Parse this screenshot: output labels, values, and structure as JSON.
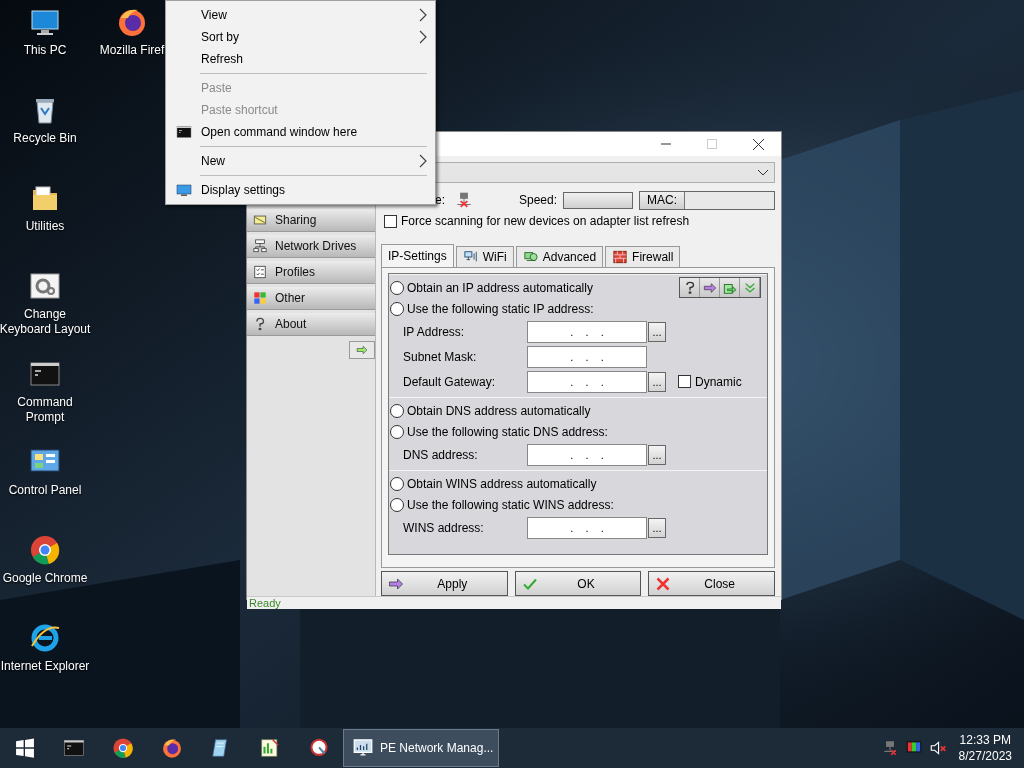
{
  "desktop": {
    "columns": [
      [
        {
          "label": "This PC",
          "kind": "pc"
        },
        {
          "label": "Recycle Bin",
          "kind": "recycle"
        },
        {
          "label": "Utilities",
          "kind": "folder"
        },
        {
          "label": "Change Keyboard Layout",
          "kind": "gear"
        },
        {
          "label": "Command Prompt",
          "kind": "cmd"
        },
        {
          "label": "Control Panel",
          "kind": "control"
        },
        {
          "label": "Google Chrome",
          "kind": "chrome"
        },
        {
          "label": "Internet Explorer",
          "kind": "ie"
        }
      ],
      [
        {
          "label": "Mozilla Firef",
          "kind": "firefox"
        }
      ]
    ]
  },
  "context_menu": {
    "items": [
      {
        "kind": "item",
        "label": "View",
        "disabled": false,
        "submenu": true
      },
      {
        "kind": "item",
        "label": "Sort by",
        "disabled": false,
        "submenu": true
      },
      {
        "kind": "item",
        "label": "Refresh",
        "disabled": false,
        "submenu": false
      },
      {
        "kind": "separator"
      },
      {
        "kind": "item",
        "label": "Paste",
        "disabled": true,
        "submenu": false
      },
      {
        "kind": "item",
        "label": "Paste shortcut",
        "disabled": true,
        "submenu": false
      },
      {
        "kind": "command",
        "label": "Open command window here",
        "disabled": false,
        "submenu": false
      },
      {
        "kind": "separator"
      },
      {
        "kind": "item",
        "label": "New",
        "disabled": false,
        "submenu": true
      },
      {
        "kind": "separator"
      },
      {
        "kind": "display",
        "label": "Display settings",
        "disabled": false,
        "submenu": false
      }
    ]
  },
  "window": {
    "sidebar": {
      "items": [
        {
          "label": "Sharing",
          "kind": "sharing"
        },
        {
          "label": "Network Drives",
          "kind": "drives"
        },
        {
          "label": "Profiles",
          "kind": "profiles"
        },
        {
          "label": "Other",
          "kind": "other"
        },
        {
          "label": "About",
          "kind": "about"
        }
      ]
    },
    "state_label": "e:",
    "speed_label": "Speed:",
    "mac_label": "MAC:",
    "force_scan": {
      "label": "Force scanning for new devices on adapter list refresh",
      "checked": false
    },
    "tabs": [
      {
        "label": "IP-Settings",
        "selected": true,
        "kind": "plain"
      },
      {
        "label": "WiFi",
        "selected": false,
        "kind": "wifi"
      },
      {
        "label": "Advanced",
        "selected": false,
        "kind": "advanced"
      },
      {
        "label": "Firewall",
        "selected": false,
        "kind": "firewall"
      }
    ],
    "sections": [
      {
        "radios": [
          {
            "label": "Obtain an IP address automatically",
            "selected": false
          },
          {
            "label": "Use the following static IP address:",
            "selected": false
          }
        ],
        "fields": [
          {
            "label": "IP Address:",
            "value": ".    .    .",
            "browse": "..."
          },
          {
            "label": "Subnet Mask:",
            "value": ".    .    ."
          },
          {
            "label": "Default Gateway:",
            "value": ".    .    .",
            "browse": "...",
            "dynamic": {
              "label": "Dynamic",
              "checked": false
            }
          }
        ]
      },
      {
        "radios": [
          {
            "label": "Obtain DNS address automatically",
            "selected": false
          },
          {
            "label": "Use the following static DNS address:",
            "selected": false
          }
        ],
        "fields": [
          {
            "label": "DNS address:",
            "value": ".    .    .",
            "browse": "..."
          }
        ]
      },
      {
        "radios": [
          {
            "label": "Obtain WINS address automatically",
            "selected": false
          },
          {
            "label": "Use the following static WINS address:",
            "selected": false
          }
        ],
        "fields": [
          {
            "label": "WINS address:",
            "value": ".    .    .",
            "browse": "..."
          }
        ]
      }
    ],
    "buttons": [
      {
        "label": "Apply",
        "kind": "apply"
      },
      {
        "label": "OK",
        "kind": "ok"
      },
      {
        "label": "Close",
        "kind": "close"
      }
    ],
    "status": "Ready"
  },
  "taskbar": {
    "pinned": [
      {
        "kind": "cmd"
      },
      {
        "kind": "chrome"
      },
      {
        "kind": "firefox"
      },
      {
        "kind": "notepad"
      },
      {
        "kind": "chart"
      },
      {
        "kind": "tool"
      }
    ],
    "task": {
      "label": "PE Network Manag...",
      "selected": true
    },
    "tray": [
      {
        "kind": "network-x"
      },
      {
        "kind": "colors"
      },
      {
        "kind": "speaker-mute"
      }
    ],
    "time": "12:33 PM",
    "date": "8/27/2023"
  }
}
